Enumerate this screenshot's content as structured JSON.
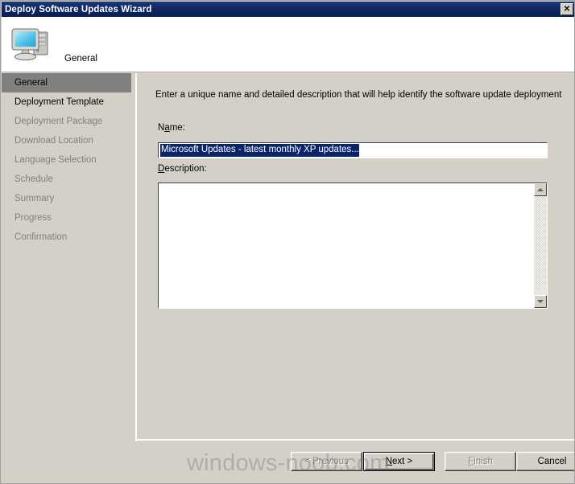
{
  "window": {
    "title": "Deploy Software Updates Wizard",
    "close_label": "✕",
    "colors": {
      "titlebar": "#0d2a66",
      "face": "#d4d0c8",
      "selection": "#0a246a",
      "disabled_text": "#808080",
      "selected_nav": "#808080"
    }
  },
  "header": {
    "title": "General",
    "icon": "computer-icon"
  },
  "sidebar": {
    "items": [
      {
        "label": "General",
        "state": "current"
      },
      {
        "label": "Deployment Template",
        "state": "next"
      },
      {
        "label": "Deployment Package",
        "state": "pending"
      },
      {
        "label": "Download Location",
        "state": "pending"
      },
      {
        "label": "Language Selection",
        "state": "pending"
      },
      {
        "label": "Schedule",
        "state": "pending"
      },
      {
        "label": "Summary",
        "state": "pending"
      },
      {
        "label": "Progress",
        "state": "pending"
      },
      {
        "label": "Confirmation",
        "state": "pending"
      }
    ]
  },
  "content": {
    "instruction": "Enter a unique name and detailed description that will help identify the software update deployment",
    "name_field": {
      "label_prefix": "N",
      "label_accel": "a",
      "label_suffix": "me:",
      "value": "Microsoft Updates - latest monthly XP updates...",
      "placeholder": "",
      "selected": true
    },
    "description_field": {
      "label_accel": "D",
      "label_suffix": "escription:",
      "value": "",
      "placeholder": ""
    },
    "scrollbar": {
      "up_icon": "arrow-up-icon",
      "down_icon": "arrow-down-icon"
    }
  },
  "buttons": {
    "previous": {
      "label": "< Previous",
      "enabled": false,
      "default": false
    },
    "next": {
      "label_prefix": "",
      "label_accel": "N",
      "label_suffix": "ext >",
      "enabled": true,
      "default": true
    },
    "finish": {
      "label_accel": "F",
      "label_suffix": "inish",
      "enabled": false,
      "default": false
    },
    "cancel": {
      "label": "Cancel",
      "enabled": true,
      "default": false
    }
  },
  "watermark": {
    "text": "windows-noob.com"
  }
}
